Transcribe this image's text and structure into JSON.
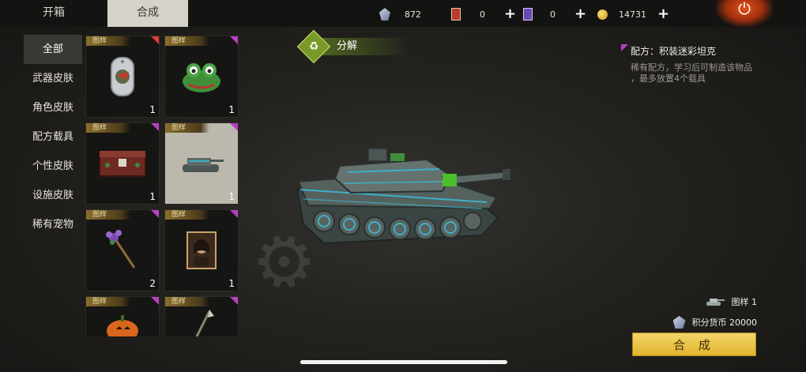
{
  "tabs": {
    "open": "开箱",
    "craft": "合成"
  },
  "currencies": [
    {
      "icon": "diamond-currency-icon",
      "value": "872"
    },
    {
      "icon": "red-card-icon",
      "value": "0"
    },
    {
      "icon": "purple-card-icon",
      "value": "0"
    },
    {
      "icon": "gold-coin-icon",
      "value": "14731"
    }
  ],
  "sidebar": {
    "items": [
      {
        "label": "全部",
        "active": true
      },
      {
        "label": "武器皮肤"
      },
      {
        "label": "角色皮肤"
      },
      {
        "label": "配方载具"
      },
      {
        "label": "个性皮肤"
      },
      {
        "label": "设施皮肤"
      },
      {
        "label": "稀有宠物"
      }
    ]
  },
  "grid": {
    "items": [
      {
        "tag": "图样",
        "count": "1",
        "icon": "dog-tag-icon",
        "rarity": "red"
      },
      {
        "tag": "图样",
        "count": "1",
        "icon": "frog-helmet-icon",
        "rarity": "purple"
      },
      {
        "tag": "图样",
        "count": "1",
        "icon": "weapon-crate-icon",
        "rarity": "purple"
      },
      {
        "tag": "图样",
        "count": "1",
        "icon": "tank-thumb-icon",
        "rarity": "purple",
        "selected": true
      },
      {
        "tag": "图样",
        "count": "2",
        "icon": "flower-staff-icon",
        "rarity": "purple"
      },
      {
        "tag": "图样",
        "count": "1",
        "icon": "portrait-icon",
        "rarity": "purple"
      },
      {
        "tag": "图样",
        "count": "",
        "icon": "pumpkin-icon",
        "rarity": "purple"
      },
      {
        "tag": "图样",
        "count": "",
        "icon": "spear-icon",
        "rarity": "purple"
      }
    ]
  },
  "decompose": {
    "label": "分解"
  },
  "info": {
    "title": "配方：积装迷彩坦克",
    "desc_line1": "稀有配方，学习后可制造该物品",
    "desc_line2": "，最多放置4个载具"
  },
  "requirement": {
    "text": "图样 1"
  },
  "cost": {
    "text": "积分货币 20000"
  },
  "craft_button": {
    "label": "合 成"
  },
  "colors": {
    "accent_gold": "#e2b52d",
    "rarity_purple": "#b73fc4",
    "rarity_red": "#e03a3a",
    "decompose_green": "#7a9a28"
  }
}
